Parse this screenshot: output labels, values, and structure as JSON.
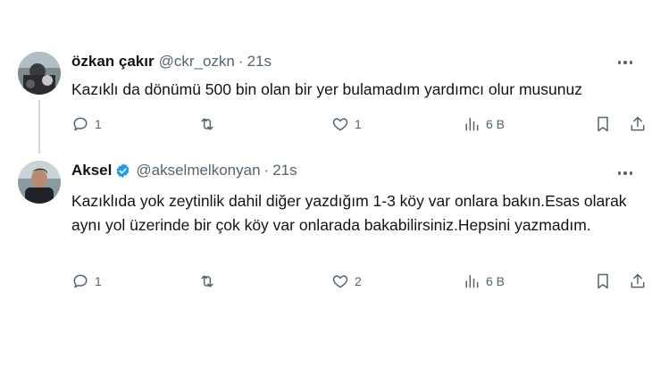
{
  "tweets": [
    {
      "name": "özkan çakır",
      "handle": "@ckr_ozkn",
      "separator": "·",
      "time": "21s",
      "text": "Kazıklı da dönümü 500 bin olan bir yer bulamadım yardımcı olur musunuz",
      "replies": "1",
      "retweets": "",
      "likes": "1",
      "views": "6 B"
    },
    {
      "name": "Aksel",
      "handle": "@akselmelkonyan",
      "separator": "·",
      "time": "21s",
      "verified": true,
      "text": "Kazıklıda yok zeytinlik dahil diğer yazdığım 1-3 köy var onlara bakın.Esas olarak aynı yol üzerinde bir çok köy var onlarada bakabilirsiniz.Hepsini yazmadım.",
      "replies": "1",
      "retweets": "",
      "likes": "2",
      "views": "6 B"
    }
  ],
  "icons": [
    "reply-icon",
    "retweet-icon",
    "like-icon",
    "views-icon",
    "bookmark-icon",
    "share-icon",
    "more-icon",
    "verified-icon"
  ],
  "colors": {
    "text": "#0f1419",
    "muted": "#536471",
    "verified": "#1d9bf0",
    "thread_line": "#cfd9de"
  }
}
